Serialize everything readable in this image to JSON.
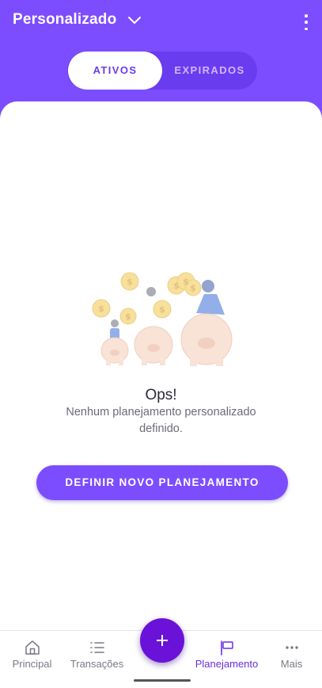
{
  "header": {
    "title": "Personalizado",
    "dropdown_icon": "chevron-down-icon",
    "menu_icon": "more-vertical-icon"
  },
  "tabs": [
    {
      "label": "ATIVOS",
      "active": true
    },
    {
      "label": "EXPIRADOS",
      "active": false
    }
  ],
  "empty_state": {
    "illustration": "piggy-banks-coins-illustration",
    "heading": "Ops!",
    "message": "Nenhum planejamento personalizado definido."
  },
  "cta": {
    "label": "DEFINIR NOVO PLANEJAMENTO"
  },
  "fab": {
    "icon": "plus-icon"
  },
  "bottom_nav": [
    {
      "label": "Principal",
      "icon": "home-icon",
      "active": false
    },
    {
      "label": "Transações",
      "icon": "list-icon",
      "active": false
    },
    {
      "label": "Planejamento",
      "icon": "flag-icon",
      "active": true
    },
    {
      "label": "Mais",
      "icon": "more-horizontal-icon",
      "active": false
    }
  ],
  "colors": {
    "primary": "#7c4dff",
    "fab": "#6a12d8",
    "active_nav": "#6a2de0",
    "coin": "#f3c74a",
    "piggy": "#f4cdb5"
  }
}
